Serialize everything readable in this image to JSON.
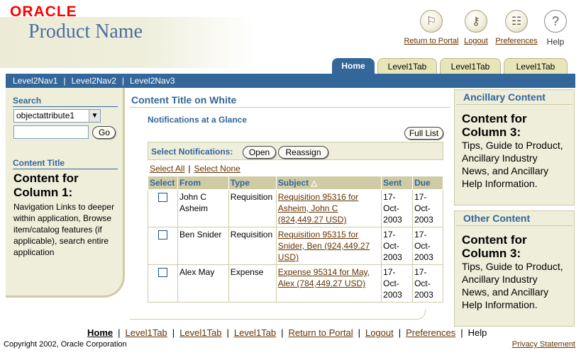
{
  "brand": {
    "logo": "ORACLE",
    "product": "Product Name"
  },
  "global": [
    {
      "label": "Return to Portal",
      "icon": "portal-icon"
    },
    {
      "label": "Logout",
      "icon": "logout-icon"
    },
    {
      "label": "Preferences",
      "icon": "preferences-icon"
    },
    {
      "label": "Help",
      "icon": "help-icon"
    }
  ],
  "tabs": [
    "Home",
    "Level1Tab",
    "Level1Tab",
    "Level1Tab"
  ],
  "level2": [
    "Level2Nav1",
    "Level2Nav2",
    "Level2Nav3"
  ],
  "search": {
    "header": "Search",
    "select": "objectattribute1",
    "input": "",
    "go": "Go"
  },
  "col1": {
    "header": "Content Title",
    "title": "Content for Column 1:",
    "text": "Navigation Links to deeper within application, Browse item/catalog features (if applicable), search entire application"
  },
  "main": {
    "title": "Content Title on White",
    "notif_title": "Notifications at a Glance",
    "full_list": "Full List",
    "select_label": "Select Notifications:",
    "open": "Open",
    "reassign": "Reassign",
    "select_all": "Select All",
    "select_none": "Select None",
    "columns": [
      "Select",
      "From",
      "Type",
      "Subject",
      "Sent",
      "Due"
    ],
    "sort_indicator": "△",
    "rows": [
      {
        "from": "John C Asheim",
        "type": "Requisition",
        "subject": "Requisition 95316 for Asheim, John C (824,449.27 USD)",
        "sent": "17-Oct-2003",
        "due": "17-Oct-2003"
      },
      {
        "from": "Ben Snider",
        "type": "Requisition",
        "subject": "Requisition 95315 for Snider, Ben (924,449.27 USD)",
        "sent": "17-Oct-2003",
        "due": "17-Oct-2003"
      },
      {
        "from": "Alex May",
        "type": "Expense",
        "subject": "Expense 95314 for May, Alex (784,449.27 USD)",
        "sent": "17-Oct-2003",
        "due": "17-Oct-2003"
      }
    ]
  },
  "ancillary": {
    "header": "Ancillary Content",
    "title": "Content for Column 3:",
    "text": "Tips, Guide to Product, Ancillary Industry News, and Ancillary Help Information."
  },
  "other": {
    "header": "Other Content",
    "title": "Content for Column 3:",
    "text": "Tips, Guide to Product, Ancillary Industry News, and Ancillary Help Information."
  },
  "footer": {
    "links": [
      "Home",
      "Level1Tab",
      "Level1Tab",
      "Level1Tab",
      "Return to Portal",
      "Logout",
      "Preferences",
      "Help"
    ],
    "copyright": "Copyright 2002, Oracle Corporation",
    "privacy": "Privacy Statement"
  },
  "colors": {
    "accent": "#336699",
    "panel": "#eeeedb",
    "border": "#cfcba4",
    "link": "#663300",
    "logo": "#ff0000"
  }
}
